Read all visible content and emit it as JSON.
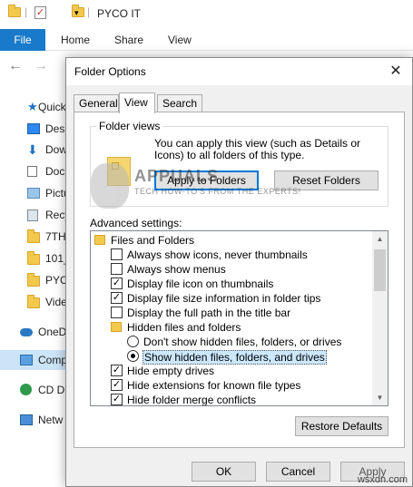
{
  "explorer": {
    "window_title": "PYCO IT",
    "ribbon_tabs": [
      "File",
      "Home",
      "Share",
      "View"
    ],
    "nav_items": [
      {
        "label": "Quick",
        "icon": "star-icon"
      },
      {
        "label": "Desk",
        "icon": "desktop-icon"
      },
      {
        "label": "Dow",
        "icon": "download-arrow-icon"
      },
      {
        "label": "Doc",
        "icon": "document-icon"
      },
      {
        "label": "Pictu",
        "icon": "pictures-icon"
      },
      {
        "label": "Recy",
        "icon": "recycle-bin-icon"
      },
      {
        "label": "7TH",
        "icon": "folder-icon"
      },
      {
        "label": "101_",
        "icon": "folder-icon"
      },
      {
        "label": "PYCO",
        "icon": "folder-icon"
      },
      {
        "label": "Vide",
        "icon": "folder-icon"
      },
      {
        "label": "OneD",
        "icon": "onedrive-cloud-icon"
      },
      {
        "label": "Comp",
        "icon": "computer-icon"
      },
      {
        "label": "CD Dr",
        "icon": "cd-drive-icon"
      },
      {
        "label": "Netw",
        "icon": "network-icon"
      }
    ]
  },
  "dialog": {
    "title": "Folder Options",
    "tabs": [
      "General",
      "View",
      "Search"
    ],
    "folder_views": {
      "label": "Folder views",
      "description": "You can apply this view (such as Details or Icons) to all folders of this type.",
      "apply_button": "Apply to Folders",
      "reset_button": "Reset Folders"
    },
    "advanced_label": "Advanced settings:",
    "advanced": [
      {
        "type": "folder",
        "label": "Files and Folders"
      },
      {
        "type": "checkbox",
        "checked": false,
        "label": "Always show icons, never thumbnails"
      },
      {
        "type": "checkbox",
        "checked": false,
        "label": "Always show menus"
      },
      {
        "type": "checkbox",
        "checked": true,
        "label": "Display file icon on thumbnails"
      },
      {
        "type": "checkbox",
        "checked": true,
        "label": "Display file size information in folder tips"
      },
      {
        "type": "checkbox",
        "checked": false,
        "label": "Display the full path in the title bar"
      },
      {
        "type": "folder",
        "label": "Hidden files and folders"
      },
      {
        "type": "radio",
        "checked": false,
        "label": "Don't show hidden files, folders, or drives"
      },
      {
        "type": "radio",
        "checked": true,
        "label": "Show hidden files, folders, and drives"
      },
      {
        "type": "checkbox",
        "checked": true,
        "label": "Hide empty drives"
      },
      {
        "type": "checkbox",
        "checked": true,
        "label": "Hide extensions for known file types"
      },
      {
        "type": "checkbox",
        "checked": true,
        "label": "Hide folder merge conflicts"
      }
    ],
    "restore_button": "Restore Defaults",
    "ok_button": "OK",
    "cancel_button": "Cancel",
    "apply_button": "Apply"
  },
  "watermark": {
    "title": "APPUALS",
    "subtitle": "TECH HOW-TO'S FROM THE EXPERTS!"
  },
  "credit": "wsxdn.com",
  "colors": {
    "accent": "#0078d7",
    "file_tab": "#1979ca",
    "selection": "#cce8ff"
  }
}
